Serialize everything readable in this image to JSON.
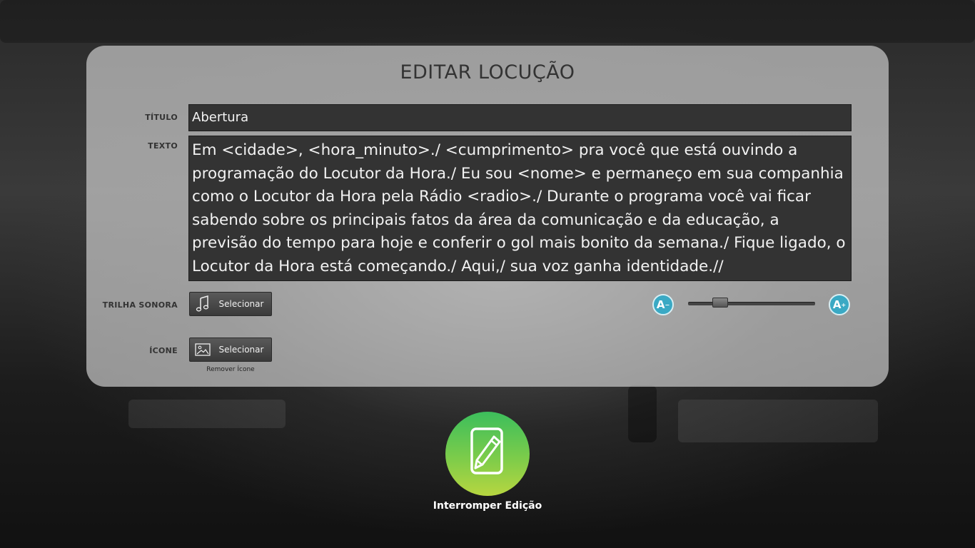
{
  "page": {
    "heading": "EDITAR LOCUÇÃO"
  },
  "form": {
    "title_label": "TÍTULO",
    "title_value": "Abertura",
    "text_label": "TEXTO",
    "text_value": "Em <cidade>, <hora_minuto>./ <cumprimento> pra você que está ouvindo a programação do Locutor da Hora./  Eu sou <nome> e  permaneço em sua companhia como o Locutor da Hora pela Rádio <radio>./ Durante o programa você vai ficar sabendo sobre os principais fatos da área da comunicação e da educação, a previsão do tempo para hoje e conferir o gol mais bonito da semana./ Fique ligado, o Locutor da Hora  está começando./ Aqui,/ sua voz ganha identidade.//",
    "soundtrack_label": "TRILHA SONORA",
    "soundtrack_button": "Selecionar",
    "icon_label": "ÍCONE",
    "icon_button": "Selecionar",
    "remove_icon_link": "Remover Ícone"
  },
  "font_size": {
    "decrease_label": "A",
    "increase_label": "A",
    "slider_value": 0.22
  },
  "actions": {
    "stop_edit_label": "Interromper Edição"
  },
  "colors": {
    "accent_blue": "#3aa9c4",
    "field_bg": "#333333",
    "action_green": "#3cbe5c",
    "action_yellow": "#b7d640"
  }
}
